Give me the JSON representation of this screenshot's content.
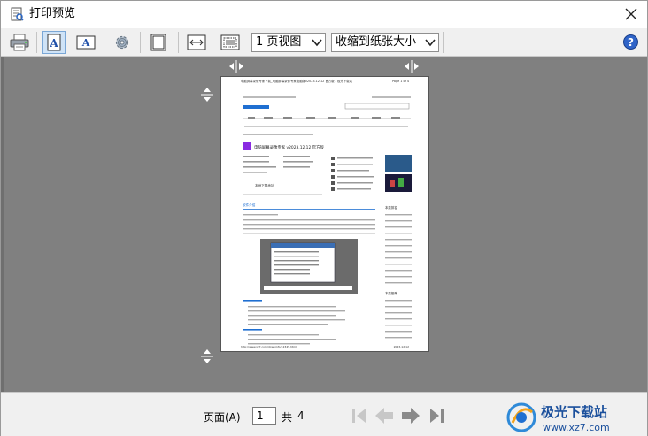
{
  "window": {
    "title": "打印预览"
  },
  "toolbar": {
    "view_select": {
      "value": "1 页视图"
    },
    "zoom_select": {
      "value": "收缩到纸张大小"
    }
  },
  "status": {
    "page_label": "页面(A)",
    "page_input": "1",
    "of_label": "共",
    "total_pages": "4"
  },
  "preview": {
    "header_left": "电脑屏幕录像专家下载_电脑屏幕录像专家电脑版v2023.12.12 官方版 - 极光下载站",
    "header_right": "Page 1 of 4",
    "software_title": "电脑屏幕录像专家 v2023.12.12 官方版",
    "download_label": "本地下载地址",
    "tab_intro": "软件介绍",
    "section_recommend": "本类排名",
    "section_hot": "本类推荐",
    "footer_url": "http://www.xz7.com/downinfo/12345.html",
    "footer_date": "2023-12-12"
  },
  "watermark": {
    "brand": "极光下载站",
    "url": "www.xz7.com"
  },
  "colors": {
    "canvas": "#808080",
    "accent": "#1f6fd1"
  }
}
